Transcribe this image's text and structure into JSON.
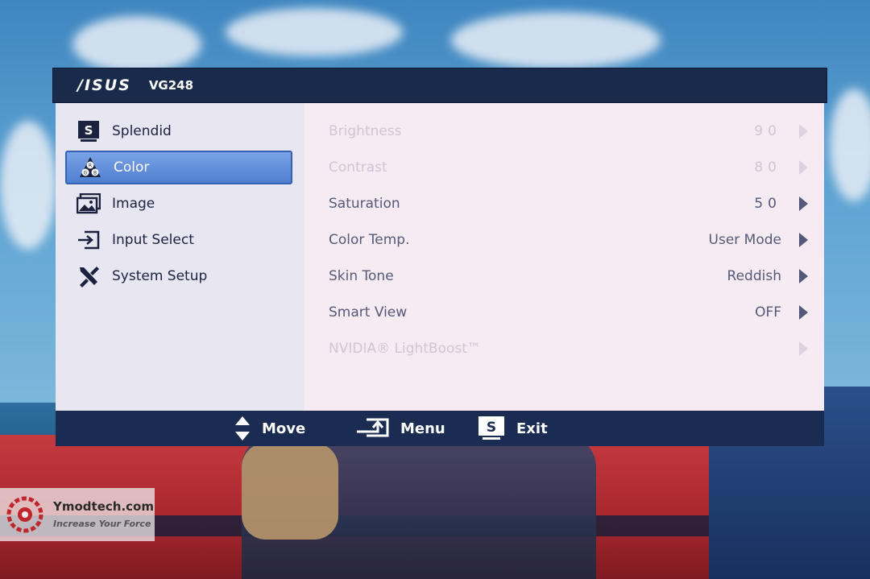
{
  "header": {
    "brand": "/ISUS",
    "model": "VG248"
  },
  "sidebar": {
    "items": [
      {
        "label": "Splendid",
        "icon": "splendid-s-icon"
      },
      {
        "label": "Color",
        "icon": "color-rgb-icon",
        "active": true
      },
      {
        "label": "Image",
        "icon": "image-icon"
      },
      {
        "label": "Input Select",
        "icon": "input-select-icon"
      },
      {
        "label": "System Setup",
        "icon": "wrench-screwdriver-icon"
      }
    ]
  },
  "settings": {
    "rows": [
      {
        "label": "Brightness",
        "value": "90",
        "enabled": false
      },
      {
        "label": "Contrast",
        "value": "80",
        "enabled": false
      },
      {
        "label": "Saturation",
        "value": "50",
        "enabled": true
      },
      {
        "label": "Color Temp.",
        "value": "User Mode",
        "enabled": true
      },
      {
        "label": "Skin Tone",
        "value": "Reddish",
        "enabled": true
      },
      {
        "label": "Smart View",
        "value": "OFF",
        "enabled": true
      },
      {
        "label": "NVIDIA® LightBoost™",
        "value": "",
        "enabled": false
      }
    ]
  },
  "footer": {
    "move_label": "Move",
    "menu_label": "Menu",
    "exit_label": "Exit",
    "exit_key": "S"
  },
  "splendid_key": "S",
  "watermark": {
    "title": "Ymodtech.com",
    "subtitle": "Increase Your Force"
  },
  "colors": {
    "header": "#1a2a4a",
    "active": "#4f7fd0",
    "footer": "#1b2c52"
  }
}
